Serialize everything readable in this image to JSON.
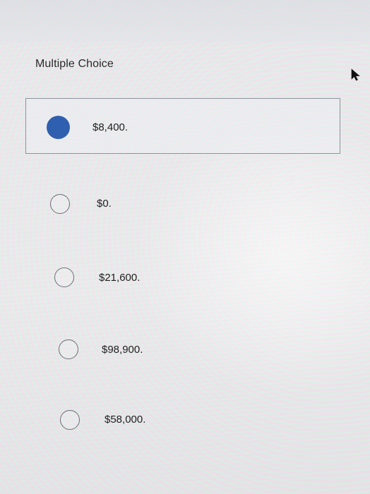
{
  "question": {
    "heading": "Multiple Choice"
  },
  "options": [
    {
      "label": "$8,400.",
      "selected": true
    },
    {
      "label": "$0.",
      "selected": false
    },
    {
      "label": "$21,600.",
      "selected": false
    },
    {
      "label": "$98,900.",
      "selected": false
    },
    {
      "label": "$58,000.",
      "selected": false
    }
  ],
  "colors": {
    "selected_radio": "#2f5faf",
    "selected_border": "#8e939c"
  },
  "icons": {
    "cursor": "mouse-pointer-icon"
  }
}
